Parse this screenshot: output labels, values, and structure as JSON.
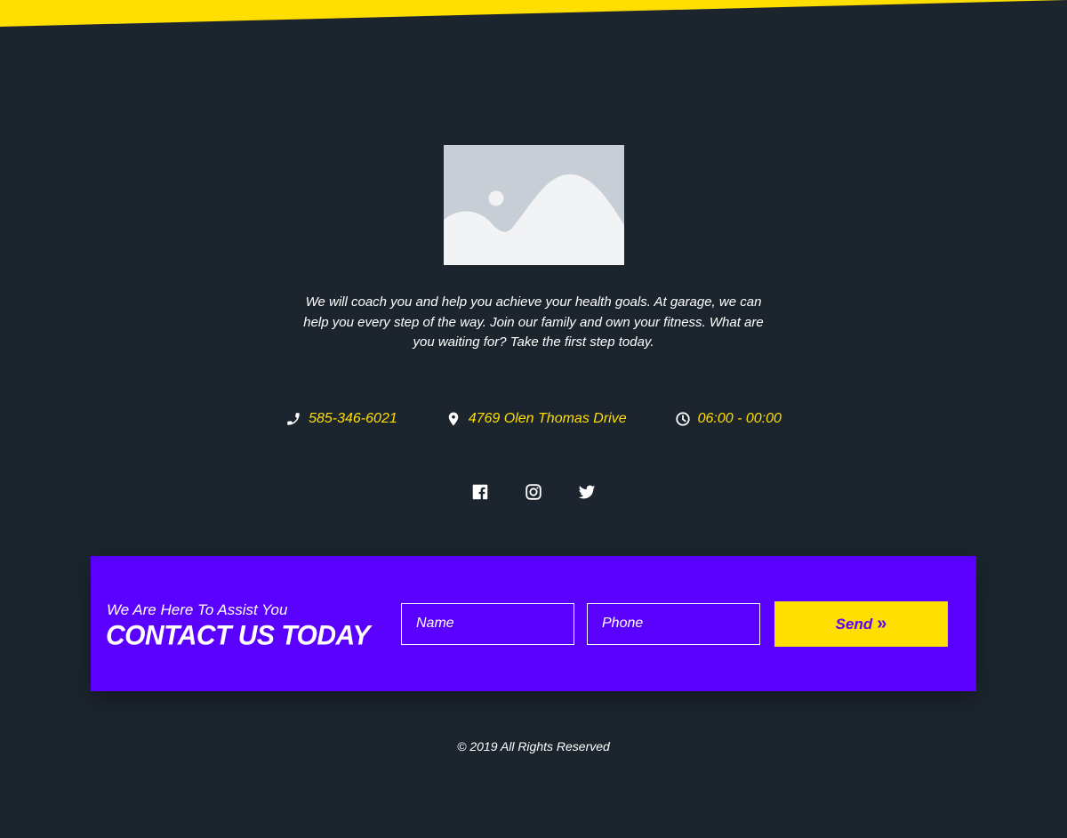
{
  "colors": {
    "page_background": "#1c252e",
    "accent_yellow": "#ffdf00",
    "contact_band": "#5a00ff",
    "image_placeholder_bg": "#c8ced5",
    "image_placeholder_fg": "#f2f3f5"
  },
  "logo": {
    "icon": "image-placeholder-icon"
  },
  "tagline": "We will coach you and help you achieve your health goals. At garage, we can help you every step of the way. Join our family and own your fitness. What are you waiting for? Take the first step today.",
  "contact_info": {
    "phone": {
      "icon": "phone-icon",
      "text": "585-346-6021"
    },
    "address": {
      "icon": "map-pin-icon",
      "text": "4769 Olen Thomas Drive"
    },
    "hours": {
      "icon": "clock-icon",
      "text": "06:00 - 00:00"
    }
  },
  "social": [
    {
      "icon": "facebook-icon"
    },
    {
      "icon": "instagram-icon"
    },
    {
      "icon": "twitter-icon"
    }
  ],
  "contact_form": {
    "subtitle": "We Are Here To Assist You",
    "title": "CONTACT US TODAY",
    "name_placeholder": "Name",
    "phone_placeholder": "Phone",
    "send_label": "Send",
    "send_icon": "double-chevron-right-icon",
    "send_glyph": "»"
  },
  "footer": {
    "copyright": "© 2019 All Rights Reserved"
  }
}
